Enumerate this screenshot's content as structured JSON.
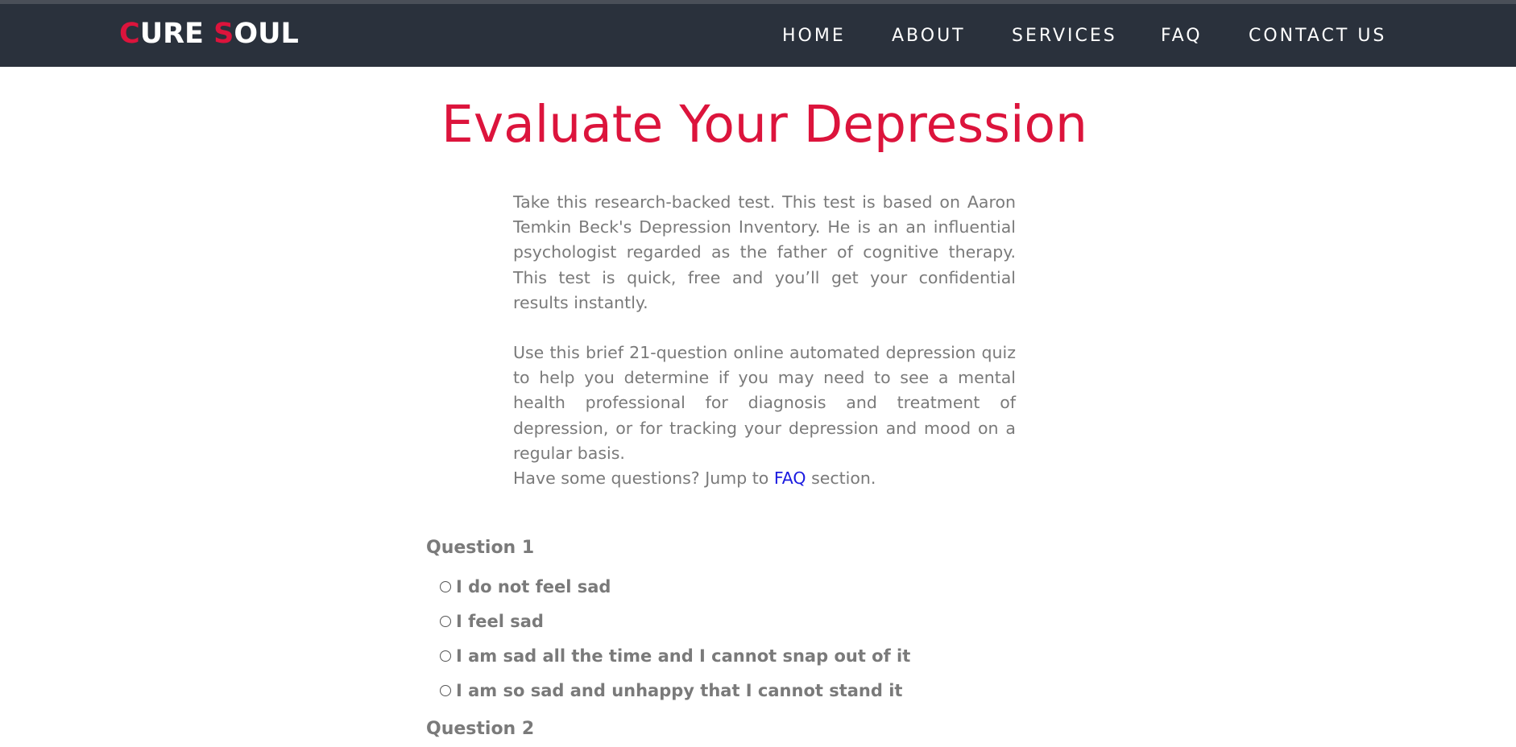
{
  "brand": {
    "first_initial": "C",
    "first_rest": "URE ",
    "second_initial": "S",
    "second_rest": "OUL",
    "accent_color": "#dc143c",
    "nav_background": "#2a313c"
  },
  "nav": {
    "items": [
      {
        "label": "HOME"
      },
      {
        "label": "ABOUT"
      },
      {
        "label": "SERVICES"
      },
      {
        "label": "FAQ"
      },
      {
        "label": "CONTACT US"
      }
    ]
  },
  "main": {
    "title": "Evaluate Your Depression",
    "intro_paragraph_1": "Take this research-backed test. This test is based on Aaron Temkin Beck's Depression Inventory. He is an an influential psychologist regarded as the father of cognitive therapy. This test is quick, free and you’ll get your confidential results instantly.",
    "intro_paragraph_2": "Use this brief 21-question online automated depression quiz to help you determine if you may need to see a mental health professional for diagnosis and treatment of depression, or for tracking your depression and mood on a regular basis.",
    "faq_prefix": "Have some questions? Jump to ",
    "faq_link_label": "FAQ",
    "faq_suffix": " section.",
    "link_color": "#1a1ae0"
  },
  "questions": [
    {
      "label": "Question 1",
      "options": [
        {
          "text": "I do not feel sad",
          "selected": false
        },
        {
          "text": "I feel sad",
          "selected": false
        },
        {
          "text": "I am sad all the time and I cannot snap out of it",
          "selected": false
        },
        {
          "text": "I am so sad and unhappy that I cannot stand it",
          "selected": false
        }
      ]
    },
    {
      "label": "Question 2",
      "options": []
    }
  ]
}
